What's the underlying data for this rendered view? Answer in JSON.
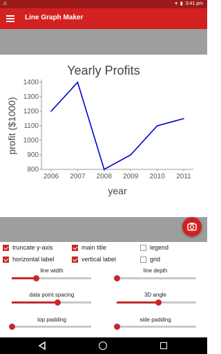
{
  "status": {
    "time": "3:41 pm"
  },
  "app": {
    "title": "Line Graph Maker"
  },
  "chart_data": {
    "type": "line",
    "title": "Yearly Profits",
    "xlabel": "year",
    "ylabel": "profit ($1000)",
    "categories": [
      "2006",
      "2007",
      "2008",
      "2009",
      "2010",
      "2011"
    ],
    "values": [
      1200,
      1400,
      800,
      900,
      1100,
      1150
    ],
    "yticks": [
      "800",
      "900",
      "1000",
      "1100",
      "1200",
      "1300",
      "1400"
    ],
    "ylim": [
      800,
      1400
    ],
    "line_color": "#0000cc",
    "grid": false
  },
  "options": {
    "truncate_yaxis": {
      "label": "truncate y-axis",
      "checked": true
    },
    "main_title": {
      "label": "main title",
      "checked": true
    },
    "legend": {
      "label": "legend",
      "checked": false
    },
    "horizontal_label": {
      "label": "horizontal label",
      "checked": true
    },
    "vertical_label": {
      "label": "vertical label",
      "checked": true
    },
    "grid": {
      "label": "grid",
      "checked": false
    }
  },
  "sliders": {
    "line_width": {
      "label": "line width",
      "value": 0.3
    },
    "line_depth": {
      "label": "line depth",
      "value": 0.0
    },
    "data_point_spacing": {
      "label": "data point spacing",
      "value": 0.57
    },
    "three_d_angle": {
      "label": "3D angle",
      "value": 0.52
    },
    "top_padding": {
      "label": "top padding",
      "value": 0.0
    },
    "side_padding": {
      "label": "side padding",
      "value": 0.0
    }
  },
  "colors": {
    "accent": "#d32121",
    "status": "#9b1b1b",
    "band": "#9e9e9e"
  }
}
